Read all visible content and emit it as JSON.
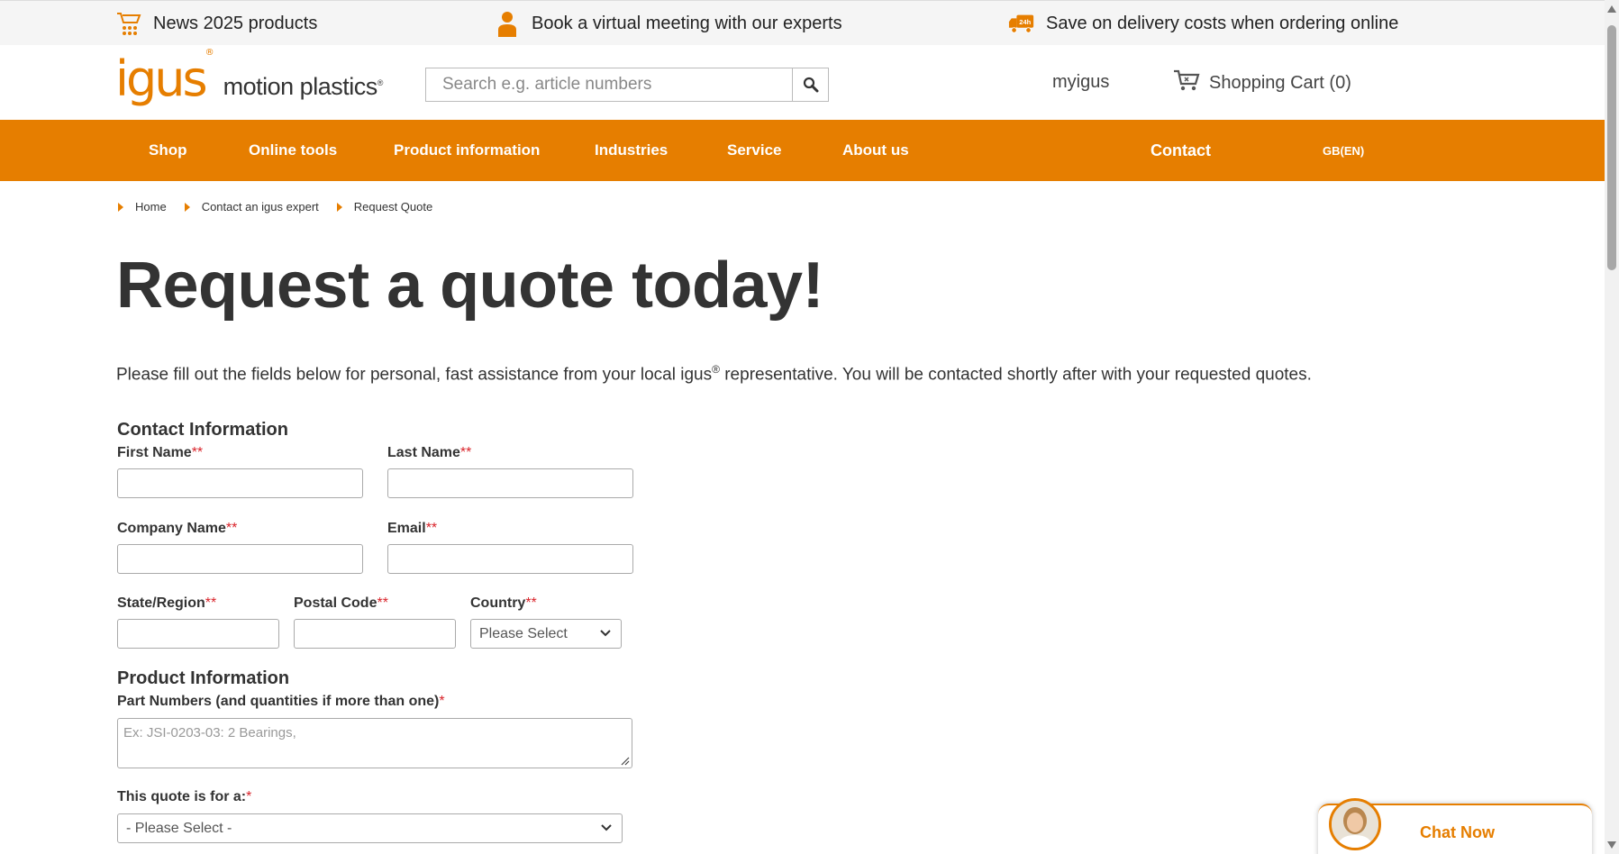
{
  "infobar": {
    "items": [
      {
        "icon": "new-products-icon",
        "text": "News 2025 products"
      },
      {
        "icon": "person-icon",
        "text": "Book a virtual meeting with our experts"
      },
      {
        "icon": "delivery-truck-icon",
        "text": "Save on delivery costs when ordering online"
      }
    ]
  },
  "header": {
    "logo_brand": "igus",
    "logo_tagline": "motion plastics",
    "search_placeholder": "Search e.g. article numbers",
    "myigus": "myigus",
    "cart_label": "Shopping Cart (0)"
  },
  "nav": {
    "items": [
      "Shop",
      "Online tools",
      "Product information",
      "Industries",
      "Service",
      "About us"
    ],
    "contact": "Contact",
    "language": "GB(EN)"
  },
  "breadcrumb": [
    "Home",
    "Contact an igus expert",
    "Request Quote"
  ],
  "page": {
    "title": "Request a quote today!",
    "intro_before": "Please fill out the fields below for personal, fast assistance from your local igus",
    "intro_mark": "®",
    "intro_after": " representative. You will be contacted shortly after with your requested quotes."
  },
  "form": {
    "contact_heading": "Contact Information",
    "first_name": "First Name",
    "last_name": "Last Name",
    "company_name": "Company Name",
    "email": "Email",
    "state_region": "State/Region",
    "postal_code": "Postal Code",
    "country": "Country",
    "country_value": "Please Select",
    "product_heading": "Product Information",
    "part_numbers": "Part Numbers (and quantities if more than one)",
    "part_numbers_placeholder": "Ex: JSI-0203-03: 2 Bearings,",
    "quote_for": "This quote is for a:",
    "quote_for_value": "- Please Select -",
    "required_double": "**",
    "required_single": "*"
  },
  "chat": {
    "label": "Chat Now"
  },
  "colors": {
    "accent": "#e67e00",
    "required": "#d9242b",
    "text": "#333333"
  }
}
